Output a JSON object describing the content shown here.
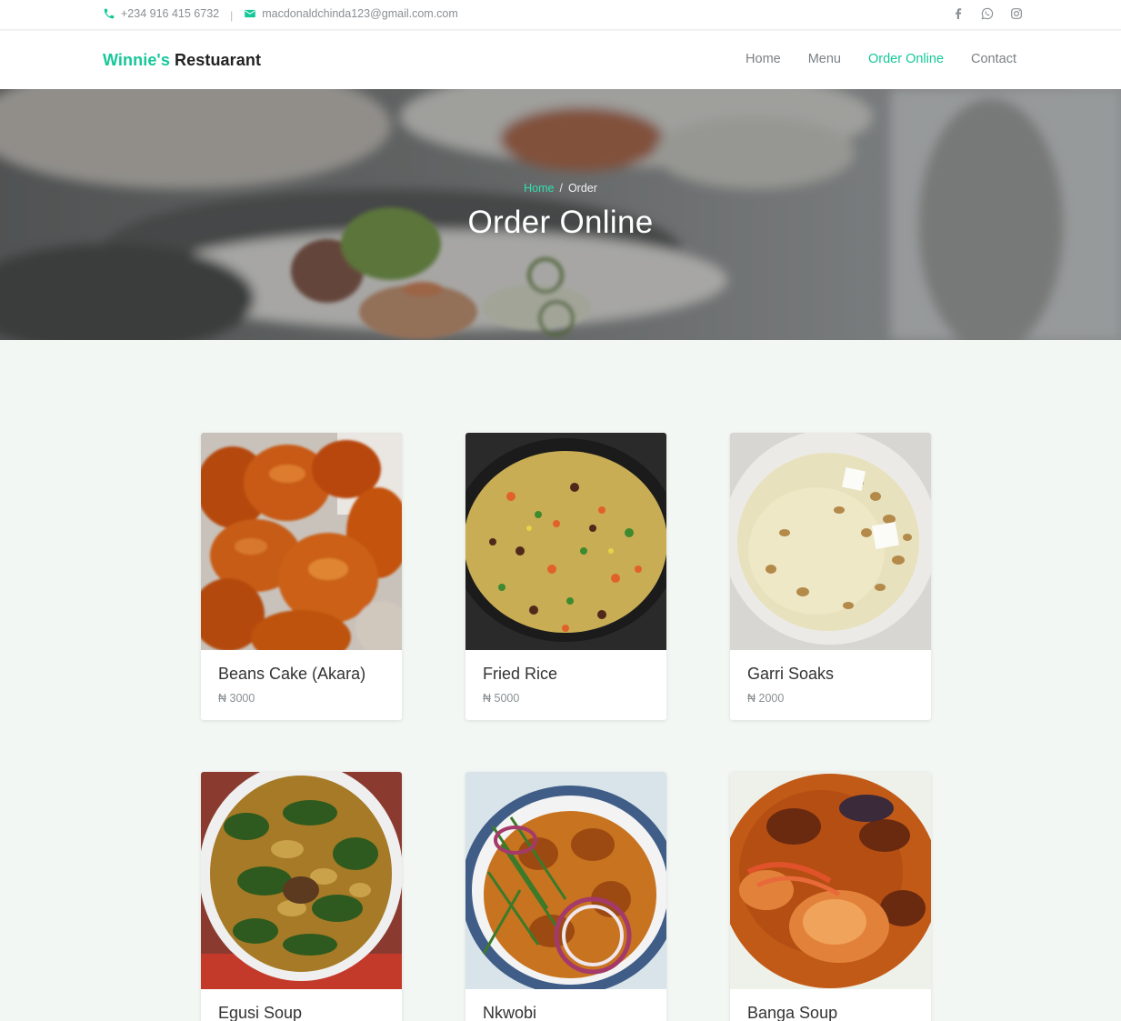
{
  "topbar": {
    "phone": "+234 916 415 6732",
    "separator": "|",
    "email": "macdonaldchinda123@gmail.com.com",
    "social_icons": [
      "facebook-icon",
      "whatsapp-icon",
      "instagram-icon"
    ]
  },
  "brand": {
    "part1": "Winnie's",
    "part2": "Restuarant"
  },
  "nav": [
    {
      "label": "Home"
    },
    {
      "label": "Menu"
    },
    {
      "label": "Order Online",
      "active": true
    },
    {
      "label": "Contact"
    }
  ],
  "hero": {
    "breadcrumb_home": "Home",
    "breadcrumb_separator": "/",
    "breadcrumb_current": "Order",
    "title": "Order Online"
  },
  "products": [
    {
      "name": "Beans Cake (Akara)",
      "price": "₦ 3000"
    },
    {
      "name": "Fried Rice",
      "price": "₦ 5000"
    },
    {
      "name": "Garri Soaks",
      "price": "₦ 2000"
    },
    {
      "name": "Egusi Soup"
    },
    {
      "name": "Nkwobi"
    },
    {
      "name": "Banga Soup"
    }
  ],
  "colors": {
    "accent": "#16c79a",
    "page_bg": "#f3f7f4"
  }
}
